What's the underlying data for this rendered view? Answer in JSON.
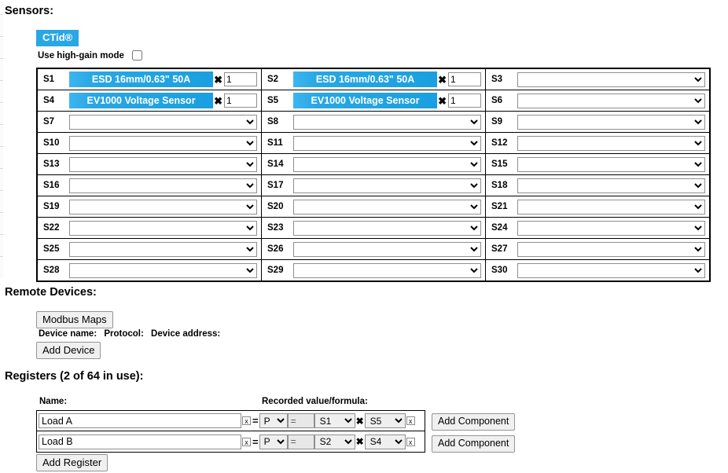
{
  "sensors": {
    "title": "Sensors:",
    "ctid_button": "CTid®",
    "high_gain_label": "Use high-gain mode",
    "high_gain_checked": false,
    "columns": 3,
    "cells": [
      {
        "label": "S1",
        "type": "pill",
        "value": "ESD 16mm/0.63\" 50A",
        "multiplier": "1"
      },
      {
        "label": "S2",
        "type": "pill",
        "value": "ESD 16mm/0.63\" 50A",
        "multiplier": "1"
      },
      {
        "label": "S3",
        "type": "select",
        "value": ""
      },
      {
        "label": "S4",
        "type": "pill",
        "value": "EV1000 Voltage Sensor",
        "multiplier": "1"
      },
      {
        "label": "S5",
        "type": "pill",
        "value": "EV1000 Voltage Sensor",
        "multiplier": "1"
      },
      {
        "label": "S6",
        "type": "select",
        "value": ""
      },
      {
        "label": "S7",
        "type": "select",
        "value": ""
      },
      {
        "label": "S8",
        "type": "select",
        "value": ""
      },
      {
        "label": "S9",
        "type": "select",
        "value": ""
      },
      {
        "label": "S10",
        "type": "select",
        "value": ""
      },
      {
        "label": "S11",
        "type": "select",
        "value": ""
      },
      {
        "label": "S12",
        "type": "select",
        "value": ""
      },
      {
        "label": "S13",
        "type": "select",
        "value": ""
      },
      {
        "label": "S14",
        "type": "select",
        "value": ""
      },
      {
        "label": "S15",
        "type": "select",
        "value": ""
      },
      {
        "label": "S16",
        "type": "select",
        "value": ""
      },
      {
        "label": "S17",
        "type": "select",
        "value": ""
      },
      {
        "label": "S18",
        "type": "select",
        "value": ""
      },
      {
        "label": "S19",
        "type": "select",
        "value": ""
      },
      {
        "label": "S20",
        "type": "select",
        "value": ""
      },
      {
        "label": "S21",
        "type": "select",
        "value": ""
      },
      {
        "label": "S22",
        "type": "select",
        "value": ""
      },
      {
        "label": "S23",
        "type": "select",
        "value": ""
      },
      {
        "label": "S24",
        "type": "select",
        "value": ""
      },
      {
        "label": "S25",
        "type": "select",
        "value": ""
      },
      {
        "label": "S26",
        "type": "select",
        "value": ""
      },
      {
        "label": "S27",
        "type": "select",
        "value": ""
      },
      {
        "label": "S28",
        "type": "select",
        "value": ""
      },
      {
        "label": "S29",
        "type": "select",
        "value": ""
      },
      {
        "label": "S30",
        "type": "select",
        "value": ""
      }
    ],
    "multiply_symbol": "✖"
  },
  "remote_devices": {
    "title": "Remote Devices:",
    "modbus_maps_button": "Modbus Maps",
    "header_device_name": "Device name:",
    "header_protocol": "Protocol:",
    "header_device_address": "Device address:",
    "add_device_button": "Add Device"
  },
  "registers": {
    "title": "Registers (2 of 64 in use):",
    "header_name": "Name:",
    "header_value": "Recorded value/formula:",
    "delete_glyph": "x",
    "equals_glyph": "=",
    "multiply_glyph": "✖",
    "eq_box_value": "=",
    "add_component_button": "Add Component",
    "add_register_button": "Add Register",
    "rows": [
      {
        "name": "Load A",
        "quantity": "P",
        "eq_value": "=",
        "component_a": "S1",
        "component_b": "S5"
      },
      {
        "name": "Load B",
        "quantity": "P",
        "eq_value": "=",
        "component_a": "S2",
        "component_b": "S4"
      }
    ]
  },
  "colors": {
    "accent_blue": "#29a7e4",
    "pill_blue_light": "#3cb6ef",
    "button_face": "#f0f0f0",
    "disabled_field": "#e8e8e8"
  }
}
